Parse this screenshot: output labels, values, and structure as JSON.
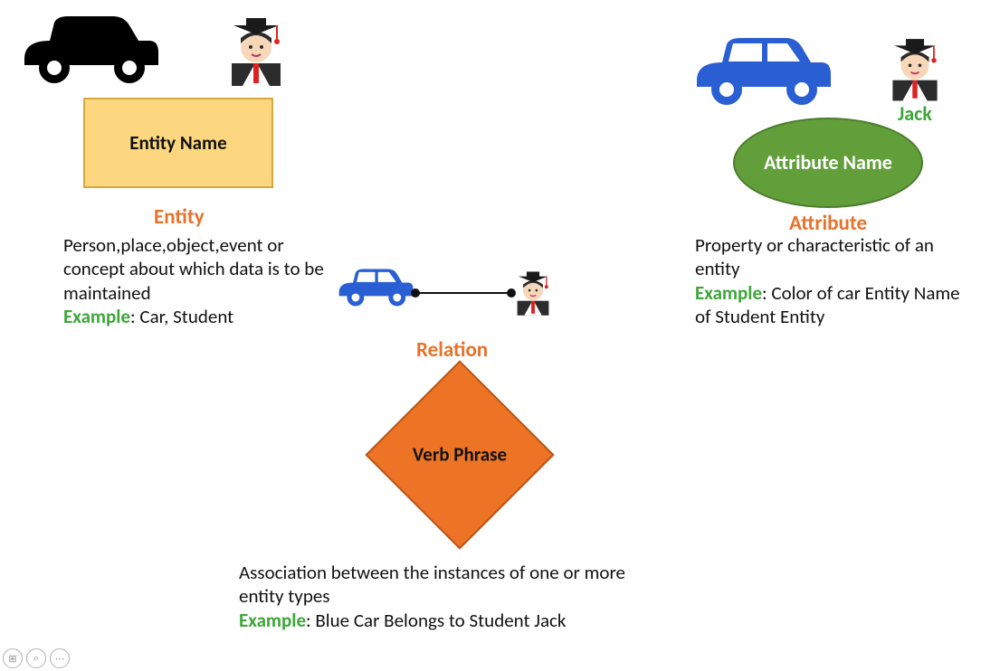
{
  "entity": {
    "boxLabel": "Entity Name",
    "title": "Entity",
    "description": "Person,place,object,event or concept about which data is to be maintained",
    "exampleLabel": "Example",
    "exampleText": ": Car, Student"
  },
  "attribute": {
    "ellipseLabel": "Attribute Name",
    "title": "Attribute",
    "nameTag": "Jack",
    "description": "Property or characteristic of an entity",
    "exampleLabel": "Example",
    "exampleText": ": Color of car Entity Name of Student Entity"
  },
  "relation": {
    "title": "Relation",
    "diamondLabel": "Verb Phrase",
    "description": "Association between the instances of one or more entity types",
    "exampleLabel": "Example",
    "exampleText": ": Blue Car Belongs to Student Jack"
  },
  "icons": {
    "carBlack": "car-icon",
    "carBlue": "car-icon",
    "student": "student-icon"
  },
  "controls": {
    "grip": "⊞",
    "zoom": "⌕",
    "more": "⋯"
  }
}
